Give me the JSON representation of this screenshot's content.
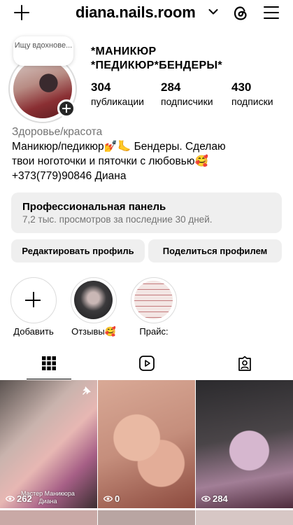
{
  "header": {
    "username": "diana.nails.room",
    "icons": {
      "create": "plus-icon",
      "switch_account": "chevron-down-icon",
      "threads": "threads-icon",
      "menu": "hamburger-menu-icon"
    }
  },
  "profile": {
    "note": "Ищу вдохнове...",
    "display_name": "*МАНИКЮР\n*ПЕДИКЮР*БЕНДЕРЫ*",
    "stats": [
      {
        "value": "304",
        "label": "публикации"
      },
      {
        "value": "284",
        "label": "подписчики"
      },
      {
        "value": "430",
        "label": "подписки"
      }
    ],
    "category": "Здоровье/красота",
    "bio_lines": [
      "Маникюр/педикюр💅🦶 Бендеры. Сделаю",
      "твои ноготочки и пяточки с любовью🥰",
      "+373(779)90846 Диана"
    ]
  },
  "dashboard": {
    "title": "Профессиональная панель",
    "subtitle": "7,2 тыс. просмотров за последние 30 дней."
  },
  "buttons": {
    "edit": "Редактировать профиль",
    "share": "Поделиться профилем"
  },
  "highlights": [
    {
      "label": "Добавить"
    },
    {
      "label": "Отзывы🥰"
    },
    {
      "label": "Прайс:"
    }
  ],
  "tabs": [
    {
      "icon": "grid-icon",
      "active": true
    },
    {
      "icon": "reels-icon",
      "active": false
    },
    {
      "icon": "tagged-icon",
      "active": false
    }
  ],
  "posts": [
    {
      "views": "262",
      "overlay": "Мастер Маникюра\nДиана",
      "pinned": true
    },
    {
      "views": "0",
      "overlay": "",
      "pinned": false
    },
    {
      "views": "284",
      "overlay": "",
      "pinned": false
    }
  ],
  "colors": {
    "secondary_text": "#737373",
    "button_bg": "#efefef",
    "border": "#dbdbdb"
  }
}
